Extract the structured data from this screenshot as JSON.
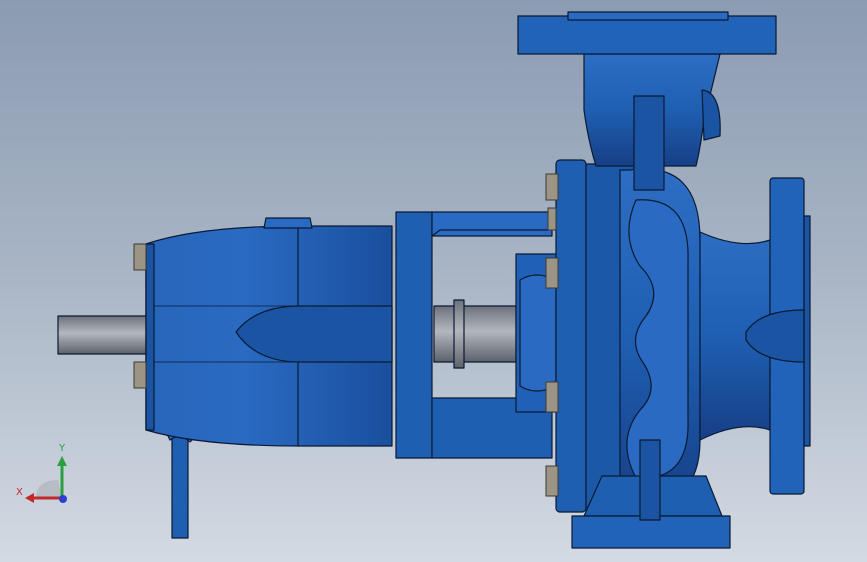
{
  "viewport": {
    "background_top": "#8b9bb2",
    "background_bottom": "#d3dae3",
    "model": {
      "part_color": "#1f5fb2",
      "part_shadow": "#123f80",
      "edge_color": "#0a1a33",
      "shaft_color": "#8a8f99",
      "bolt_color": "#9c9484"
    }
  },
  "triad": {
    "x_label": "X",
    "y_label": "Y",
    "x_color": "#c22a2a",
    "y_color": "#2aa040",
    "z_color": "#2a3fd0"
  }
}
